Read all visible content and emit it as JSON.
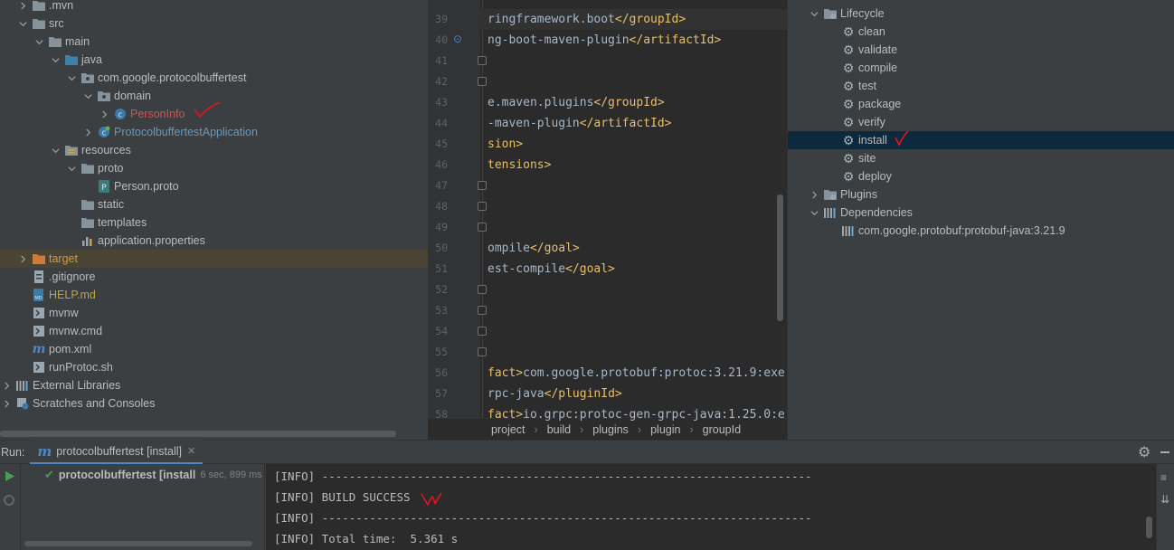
{
  "project_tree": {
    "rows": [
      {
        "label": ".mvn",
        "indent": 1,
        "expanded": false,
        "icon": "folder",
        "color": "#bbbbbb"
      },
      {
        "label": "src",
        "indent": 1,
        "expanded": true,
        "icon": "folder",
        "color": "#bbbbbb"
      },
      {
        "label": "main",
        "indent": 2,
        "expanded": true,
        "icon": "folder",
        "color": "#bbbbbb"
      },
      {
        "label": "java",
        "indent": 3,
        "expanded": true,
        "icon": "source-folder",
        "color": "#bbbbbb"
      },
      {
        "label": "com.google.protocolbuffertest",
        "indent": 4,
        "expanded": true,
        "icon": "package",
        "color": "#bbbbbb"
      },
      {
        "label": "domain",
        "indent": 5,
        "expanded": true,
        "icon": "package",
        "color": "#bbbbbb"
      },
      {
        "label": "PersonInfo",
        "indent": 6,
        "expanded": false,
        "icon": "class",
        "color": "#d25252"
      },
      {
        "label": "ProtocolbuffertestApplication",
        "indent": 5,
        "expanded": false,
        "icon": "spring-class",
        "color": "#6897bb"
      },
      {
        "label": "resources",
        "indent": 3,
        "expanded": true,
        "icon": "resources-folder",
        "color": "#bbbbbb"
      },
      {
        "label": "proto",
        "indent": 4,
        "expanded": true,
        "icon": "folder",
        "color": "#bbbbbb"
      },
      {
        "label": "Person.proto",
        "indent": 5,
        "expanded": null,
        "icon": "proto-file",
        "color": "#bbbbbb"
      },
      {
        "label": "static",
        "indent": 4,
        "expanded": null,
        "icon": "folder",
        "color": "#bbbbbb"
      },
      {
        "label": "templates",
        "indent": 4,
        "expanded": null,
        "icon": "folder",
        "color": "#bbbbbb"
      },
      {
        "label": "application.properties",
        "indent": 4,
        "expanded": null,
        "icon": "properties-file",
        "color": "#bbbbbb"
      },
      {
        "label": "target",
        "indent": 1,
        "expanded": false,
        "icon": "excluded-folder",
        "color": "#d19a3e",
        "selected": true
      },
      {
        "label": ".gitignore",
        "indent": 1,
        "expanded": null,
        "icon": "gitignore-file",
        "color": "#bbbbbb"
      },
      {
        "label": "HELP.md",
        "indent": 1,
        "expanded": null,
        "icon": "markdown-file",
        "color": "#c0a53c"
      },
      {
        "label": "mvnw",
        "indent": 1,
        "expanded": null,
        "icon": "shell-file",
        "color": "#bbbbbb"
      },
      {
        "label": "mvnw.cmd",
        "indent": 1,
        "expanded": null,
        "icon": "shell-file",
        "color": "#bbbbbb"
      },
      {
        "label": "pom.xml",
        "indent": 1,
        "expanded": null,
        "icon": "maven-file",
        "color": "#bbbbbb"
      },
      {
        "label": "runProtoc.sh",
        "indent": 1,
        "expanded": null,
        "icon": "shell-file",
        "color": "#bbbbbb"
      },
      {
        "label": "External Libraries",
        "indent": 0,
        "expanded": false,
        "icon": "libraries",
        "color": "#bbbbbb"
      },
      {
        "label": "Scratches and Consoles",
        "indent": 0,
        "expanded": false,
        "icon": "scratches",
        "color": "#bbbbbb"
      }
    ]
  },
  "editor": {
    "lines": [
      {
        "num": "39",
        "segments": [
          [
            "t",
            "ringframework.boot"
          ],
          [
            "tg",
            "</"
          ],
          [
            "tg",
            "groupId"
          ],
          [
            "tg",
            ">"
          ]
        ]
      },
      {
        "num": "40",
        "segments": [
          [
            "t",
            "ng-boot-maven-plugin"
          ],
          [
            "tg",
            "</artifactId>"
          ]
        ]
      },
      {
        "num": "41",
        "segments": []
      },
      {
        "num": "42",
        "segments": []
      },
      {
        "num": "43",
        "segments": [
          [
            "t",
            "e.maven.plugins"
          ],
          [
            "tg",
            "</groupId>"
          ]
        ]
      },
      {
        "num": "44",
        "segments": [
          [
            "t",
            "-maven-plugin"
          ],
          [
            "tg",
            "</artifactId>"
          ]
        ]
      },
      {
        "num": "45",
        "segments": [
          [
            "tg",
            "sion>"
          ]
        ]
      },
      {
        "num": "46",
        "segments": [
          [
            "tg",
            "tensions>"
          ]
        ]
      },
      {
        "num": "47",
        "segments": []
      },
      {
        "num": "48",
        "segments": []
      },
      {
        "num": "49",
        "segments": []
      },
      {
        "num": "50",
        "segments": [
          [
            "t",
            "ompile"
          ],
          [
            "tg",
            "</goal>"
          ]
        ]
      },
      {
        "num": "51",
        "segments": [
          [
            "t",
            "est-compile"
          ],
          [
            "tg",
            "</goal>"
          ]
        ]
      },
      {
        "num": "52",
        "segments": []
      },
      {
        "num": "53",
        "segments": []
      },
      {
        "num": "54",
        "segments": []
      },
      {
        "num": "55",
        "segments": []
      },
      {
        "num": "56",
        "segments": [
          [
            "tg",
            "fact>"
          ],
          [
            "t",
            "com.google.protobuf:protoc:3.21.9:exe"
          ]
        ]
      },
      {
        "num": "57",
        "segments": [
          [
            "t",
            "rpc-java"
          ],
          [
            "tg",
            "</pluginId>"
          ]
        ]
      },
      {
        "num": "58",
        "segments": [
          [
            "tg",
            "fact>"
          ],
          [
            "t",
            "io.grpc:protoc-gen-grpc-java:1.25.0:e"
          ]
        ]
      }
    ],
    "breadcrumbs": [
      "project",
      "build",
      "plugins",
      "plugin",
      "groupId"
    ]
  },
  "maven": {
    "rows": [
      {
        "label": "Lifecycle",
        "indent": 1,
        "expanded": true,
        "icon": "lifecycle-icon"
      },
      {
        "label": "clean",
        "indent": 2,
        "icon": "gear-icon"
      },
      {
        "label": "validate",
        "indent": 2,
        "icon": "gear-icon"
      },
      {
        "label": "compile",
        "indent": 2,
        "icon": "gear-icon"
      },
      {
        "label": "test",
        "indent": 2,
        "icon": "gear-icon"
      },
      {
        "label": "package",
        "indent": 2,
        "icon": "gear-icon"
      },
      {
        "label": "verify",
        "indent": 2,
        "icon": "gear-icon"
      },
      {
        "label": "install",
        "indent": 2,
        "icon": "gear-icon",
        "selected": true
      },
      {
        "label": "site",
        "indent": 2,
        "icon": "gear-icon"
      },
      {
        "label": "deploy",
        "indent": 2,
        "icon": "gear-icon"
      },
      {
        "label": "Plugins",
        "indent": 1,
        "expanded": false,
        "icon": "plugins-icon"
      },
      {
        "label": "Dependencies",
        "indent": 1,
        "expanded": true,
        "icon": "dependencies-icon"
      },
      {
        "label": "com.google.protobuf:protobuf-java:3.21.9",
        "indent": 2,
        "icon": "library-icon"
      }
    ]
  },
  "run": {
    "label": "Run:",
    "tab_label": "protocolbuffertest [install]",
    "tree_item": "protocolbuffertest [install",
    "tree_time": "6 sec, 899 ms",
    "console": [
      "[INFO] ------------------------------------------------------------------------",
      "[INFO] BUILD SUCCESS",
      "[INFO] ------------------------------------------------------------------------",
      "[INFO] Total time:  5.361 s"
    ]
  },
  "colors": {
    "accent": "#4a88c7",
    "annotation": "#e0141e",
    "success": "#499c54"
  }
}
